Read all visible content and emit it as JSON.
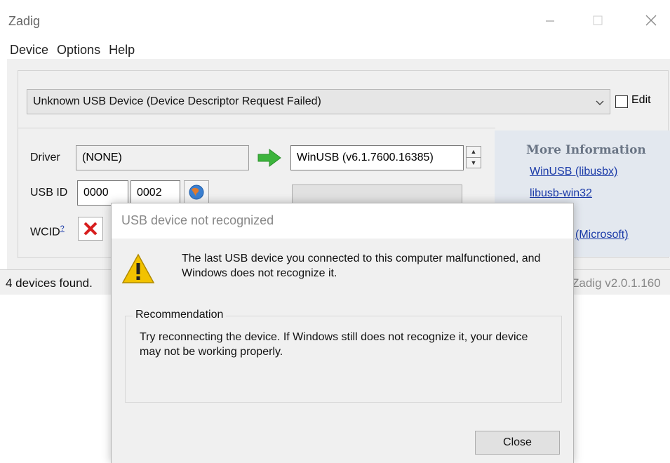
{
  "window": {
    "title": "Zadig",
    "minimize": "—",
    "maximize": "☐",
    "close": "✕"
  },
  "menu": [
    "Device",
    "Options",
    "Help"
  ],
  "device_combo": {
    "value": "Unknown USB Device (Device Descriptor Request Failed)",
    "arrow": "⌵"
  },
  "edit_label": "Edit",
  "driver": {
    "label": "Driver",
    "current": "(NONE)",
    "arrow_icon": "green-arrow-icon",
    "target": "WinUSB (v6.1.7600.16385)"
  },
  "usb_id": {
    "label": "USB ID",
    "vid": "0000",
    "pid": "0002"
  },
  "wcid": {
    "label": "WCID",
    "sup": "?"
  },
  "more_info": {
    "title": "More Information",
    "links": [
      "WinUSB (libusbx)",
      "libusb-win32",
      "(Microsoft)"
    ]
  },
  "status": {
    "left": "4 devices found.",
    "right": "Zadig v2.0.1.160"
  },
  "dialog": {
    "title": "USB device not recognized",
    "message": "The last USB device you connected to this computer malfunctioned, and Windows does not recognize it.",
    "recommendation_label": "Recommendation",
    "recommendation": "Try reconnecting the device. If Windows still does not recognize it, your device may not be working properly.",
    "close_button": "Close"
  },
  "colors": {
    "accent_link": "#1a3aa8",
    "arrow_green": "#3cb43c",
    "error_red": "#d81e1e",
    "warning_yellow": "#f2c200"
  }
}
